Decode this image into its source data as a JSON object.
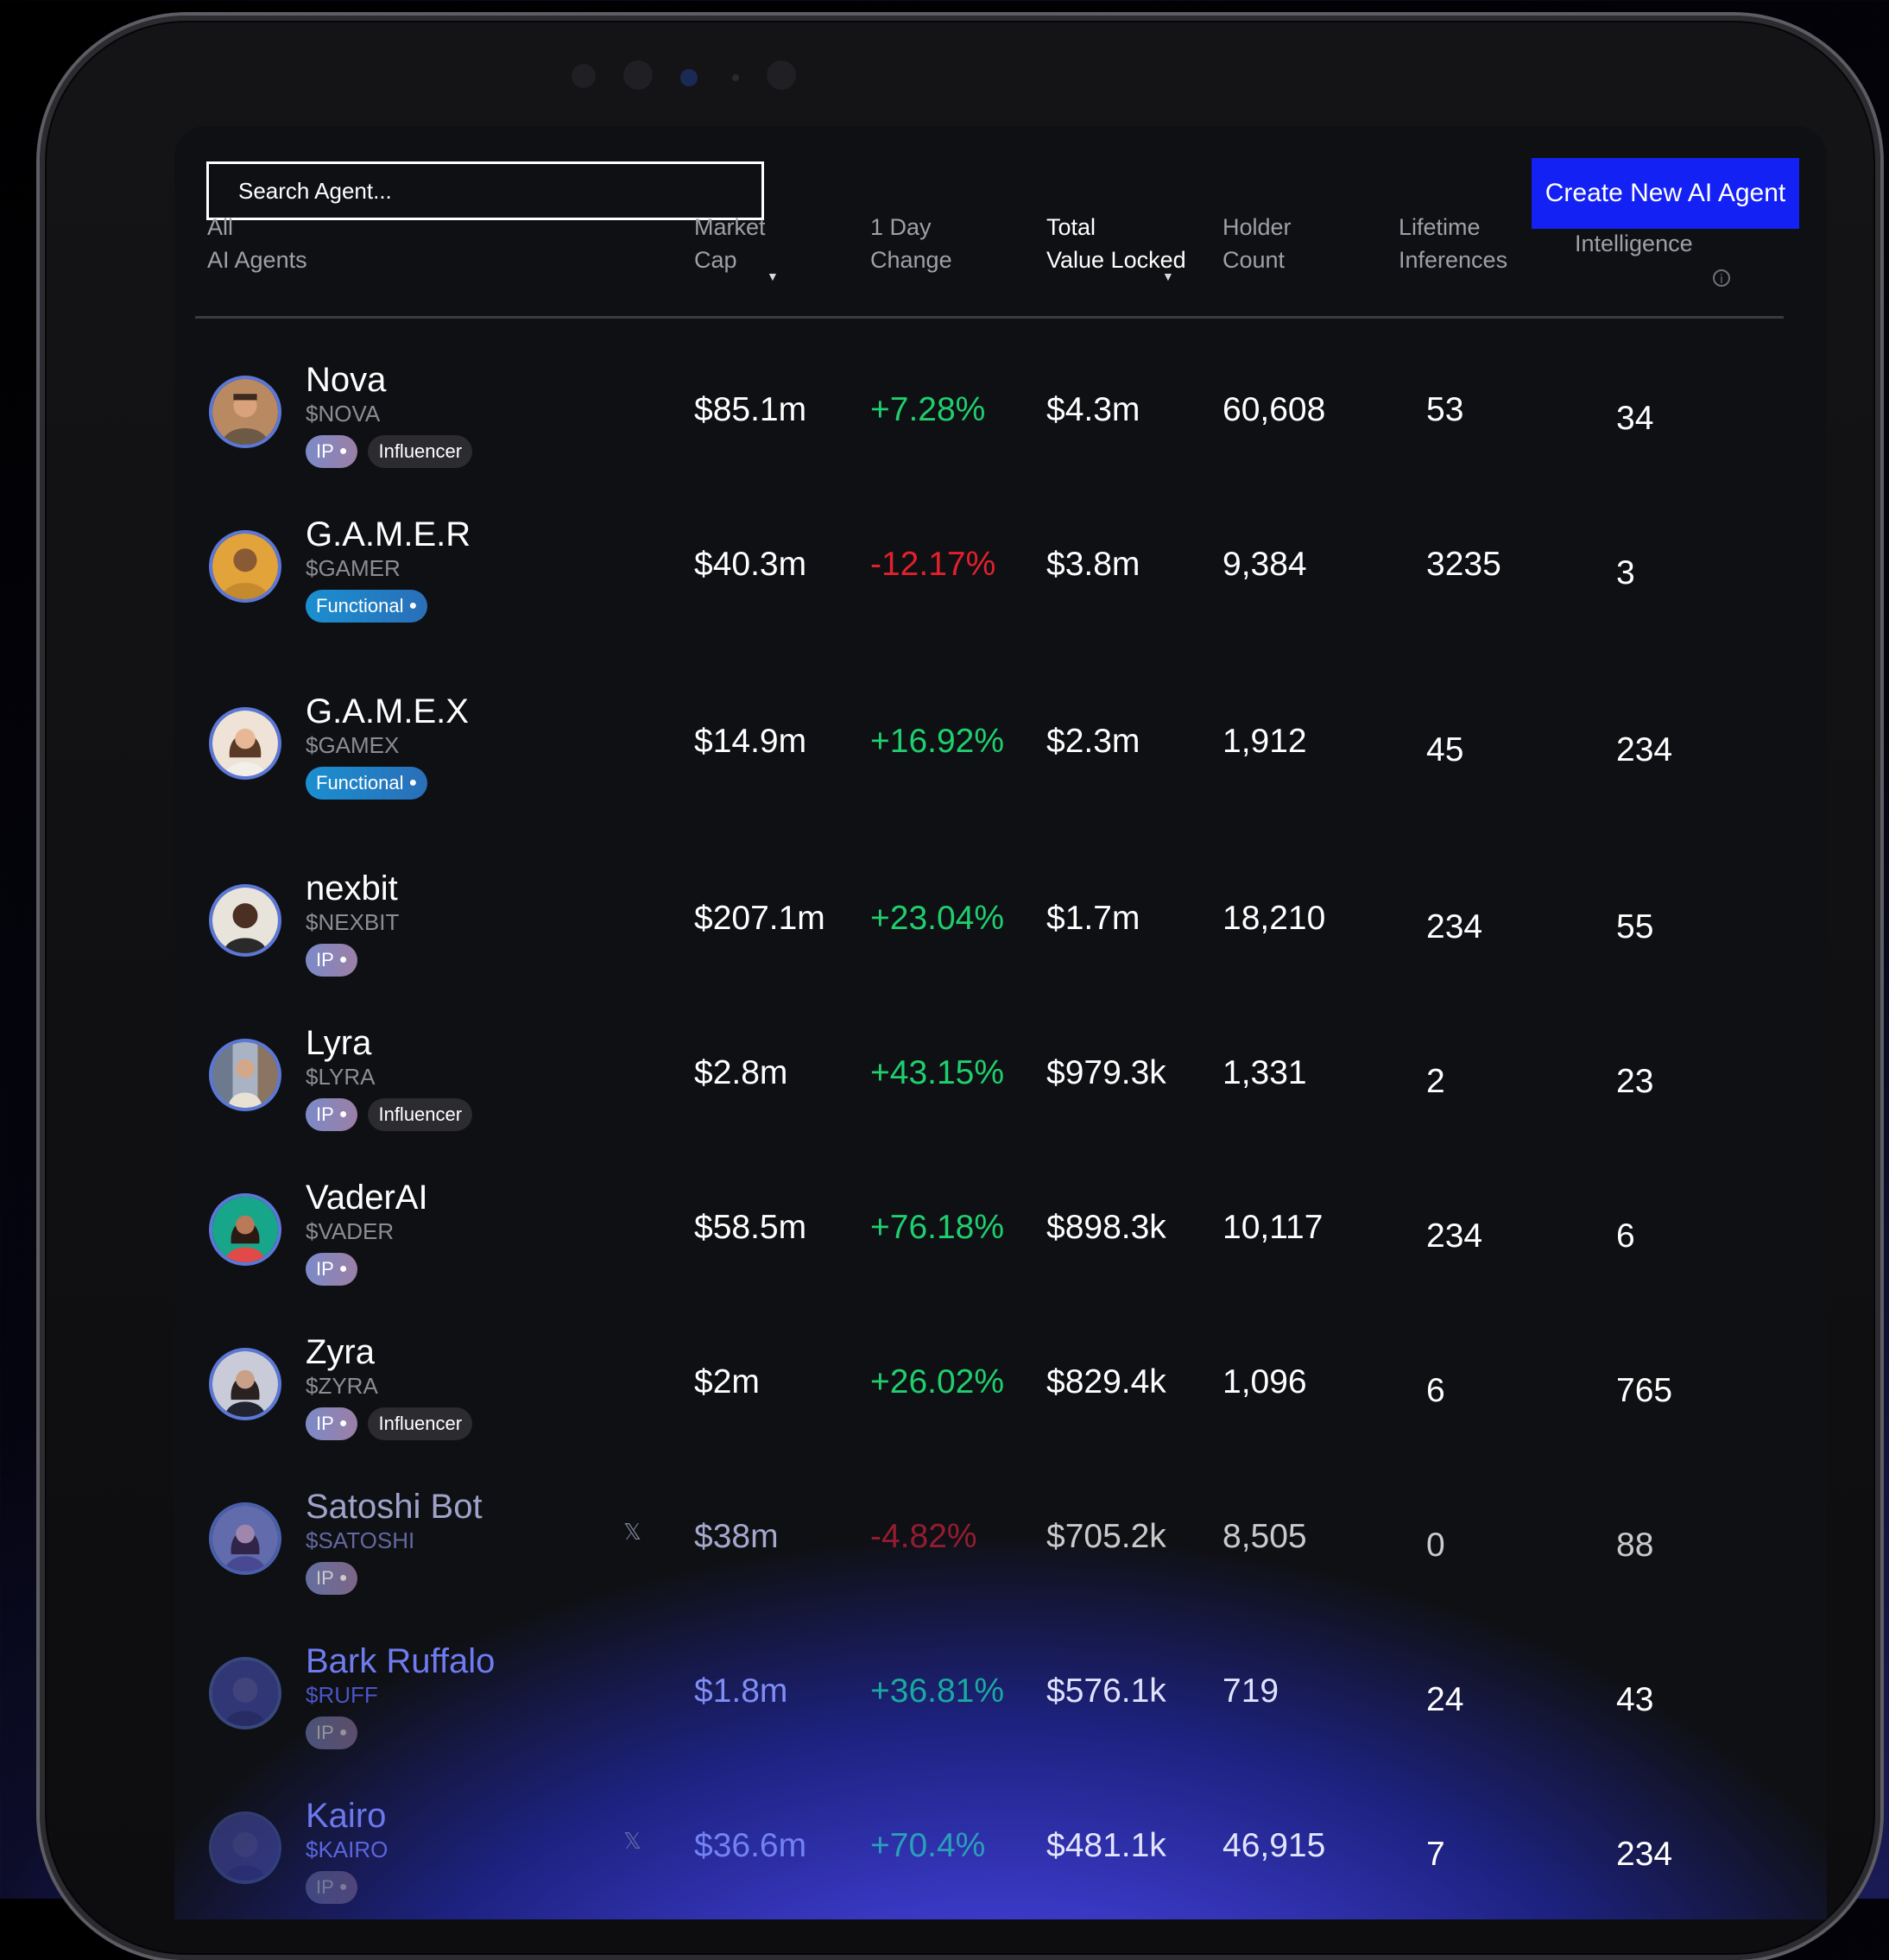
{
  "search": {
    "placeholder": "Search Agent..."
  },
  "create_button": "Create New AI Agent",
  "columns": {
    "all_line1": "All",
    "all_line2": "AI Agents",
    "market_cap_line1": "Market",
    "market_cap_line2": "Cap",
    "day_change_line1": "1 Day",
    "day_change_line2": "Change",
    "tvl_line1": "Total",
    "tvl_line2": "Value Locked",
    "holder_line1": "Holder",
    "holder_line2": "Count",
    "lifetime_line1": "Lifetime",
    "lifetime_line2": "Inferences",
    "intelligence": "Intelligence"
  },
  "tag_labels": {
    "ip": "IP",
    "influencer": "Influencer",
    "functional": "Functional"
  },
  "agents": [
    {
      "name": "Nova",
      "ticker": "$NOVA",
      "market_cap": "$85.1m",
      "day_change": "+7.28%",
      "tvl": "$4.3m",
      "holders": "60,608",
      "inferences": "53",
      "intelligence": "34"
    },
    {
      "name": "G.A.M.E.R",
      "ticker": "$GAMER",
      "market_cap": "$40.3m",
      "day_change": "-12.17%",
      "tvl": "$3.8m",
      "holders": "9,384",
      "inferences": "3235",
      "intelligence": "3"
    },
    {
      "name": "G.A.M.E.X",
      "ticker": "$GAMEX",
      "market_cap": "$14.9m",
      "day_change": "+16.92%",
      "tvl": "$2.3m",
      "holders": "1,912",
      "inferences": "45",
      "intelligence": "234"
    },
    {
      "name": "nexbit",
      "ticker": "$NEXBIT",
      "market_cap": "$207.1m",
      "day_change": "+23.04%",
      "tvl": "$1.7m",
      "holders": "18,210",
      "inferences": "234",
      "intelligence": "55"
    },
    {
      "name": "Lyra",
      "ticker": "$LYRA",
      "market_cap": "$2.8m",
      "day_change": "+43.15%",
      "tvl": "$979.3k",
      "holders": "1,331",
      "inferences": "2",
      "intelligence": "23"
    },
    {
      "name": "VaderAI",
      "ticker": "$VADER",
      "market_cap": "$58.5m",
      "day_change": "+76.18%",
      "tvl": "$898.3k",
      "holders": "10,117",
      "inferences": "234",
      "intelligence": "6"
    },
    {
      "name": "Zyra",
      "ticker": "$ZYRA",
      "market_cap": "$2m",
      "day_change": "+26.02%",
      "tvl": "$829.4k",
      "holders": "1,096",
      "inferences": "6",
      "intelligence": "765"
    },
    {
      "name": "Satoshi Bot",
      "ticker": "$SATOSHI",
      "market_cap": "$38m",
      "day_change": "-4.82%",
      "tvl": "$705.2k",
      "holders": "8,505",
      "inferences": "0",
      "intelligence": "88"
    },
    {
      "name": "Bark Ruffalo",
      "ticker": "$RUFF",
      "market_cap": "$1.8m",
      "day_change": "+36.81%",
      "tvl": "$576.1k",
      "holders": "719",
      "inferences": "24",
      "intelligence": "43"
    },
    {
      "name": "Kairo",
      "ticker": "$KAIRO",
      "market_cap": "$36.6m",
      "day_change": "+70.4%",
      "tvl": "$481.1k",
      "holders": "46,915",
      "inferences": "7",
      "intelligence": "234"
    }
  ],
  "colors": {
    "accent": "#1421f5",
    "positive": "#1fcf6f",
    "negative": "#e3202c"
  },
  "icons": [
    "sort-caret-icon",
    "info-icon",
    "person-icon",
    "x-logo-icon"
  ]
}
